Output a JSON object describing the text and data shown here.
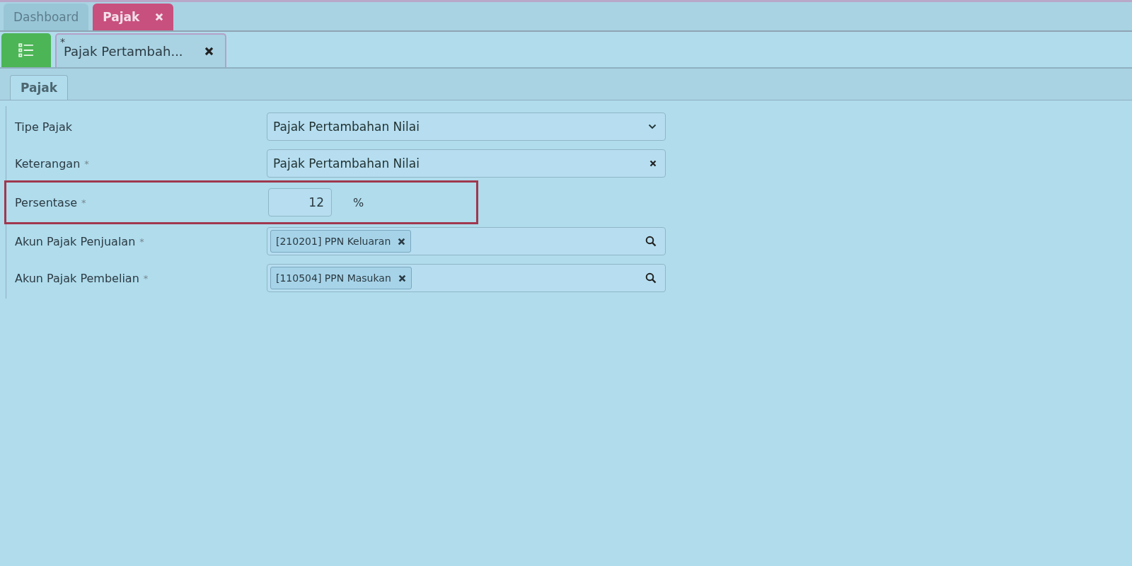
{
  "main_tabs": [
    {
      "label": "Dashboard",
      "selected": false,
      "closable": false
    },
    {
      "label": "Pajak",
      "selected": true,
      "closable": true
    }
  ],
  "doc_tabs": [
    {
      "label": "Pajak Pertambah...",
      "mark": "*",
      "closable": true
    }
  ],
  "sub_tabs": [
    {
      "label": "Pajak",
      "selected": true
    }
  ],
  "fields": [
    {
      "kind": "select",
      "label": "Tipe Pajak",
      "highlighted": false,
      "value": "Pajak Pertambahan Nilai"
    },
    {
      "kind": "text",
      "label": "Keterangan",
      "required_mark": "*",
      "highlighted": false,
      "value": "Pajak Pertambahan Nilai"
    },
    {
      "kind": "number",
      "label": "Persentase",
      "required_mark": "*",
      "highlighted": true,
      "value": "12",
      "unit": "%"
    },
    {
      "kind": "tags",
      "label": "Akun Pajak Penjualan",
      "required_mark": "*",
      "highlighted": false,
      "tags": [
        "[210201] PPN Keluaran"
      ]
    },
    {
      "kind": "tags",
      "label": "Akun Pajak Pembelian",
      "required_mark": "*",
      "highlighted": false,
      "tags": [
        "[110504] PPN Masukan"
      ]
    }
  ]
}
